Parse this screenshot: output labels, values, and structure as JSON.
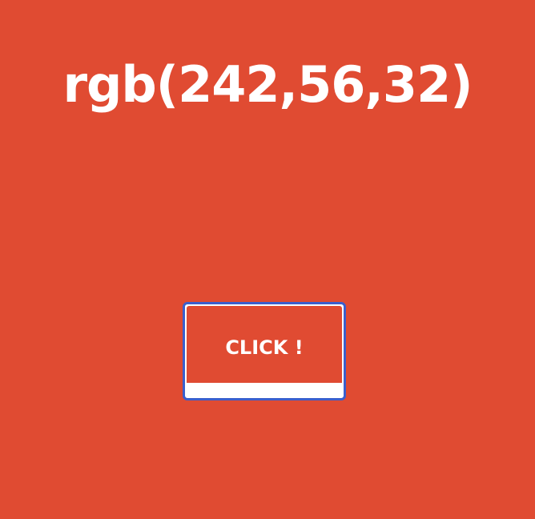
{
  "page": {
    "color_value_text": "rgb(242,56,32)",
    "background_color": "#E04B32"
  },
  "button": {
    "label": "CLICK !",
    "border_color": "#3A5FCD",
    "underside_color": "#FFFFFF"
  }
}
